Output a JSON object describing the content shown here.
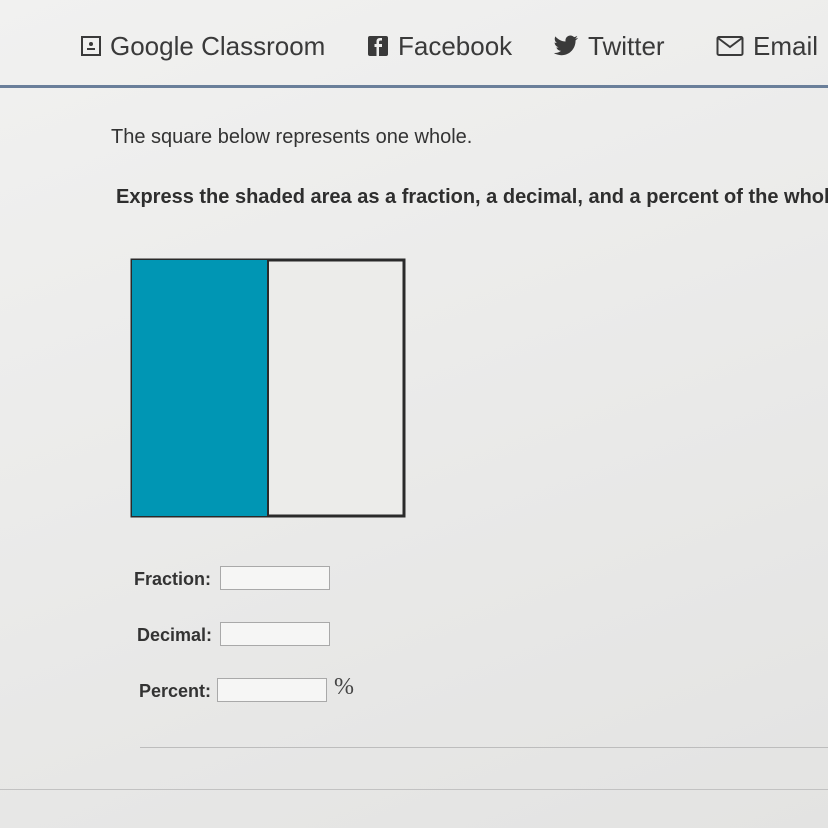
{
  "share": {
    "classroom_label": "Google Classroom",
    "facebook_label": "Facebook",
    "twitter_label": "Twitter",
    "email_label": "Email"
  },
  "problem": {
    "intro": "The square below represents one whole.",
    "question": "Express the shaded area as a fraction, a decimal, and a percent of the whole."
  },
  "figure": {
    "shaded_fraction": 0.5,
    "shade_color": "#0096b4",
    "border_color": "#2a2a2a"
  },
  "answers": {
    "fraction_label": "Fraction:",
    "fraction_value": "",
    "decimal_label": "Decimal:",
    "decimal_value": "",
    "percent_label": "Percent:",
    "percent_value": "",
    "percent_suffix": "%"
  }
}
